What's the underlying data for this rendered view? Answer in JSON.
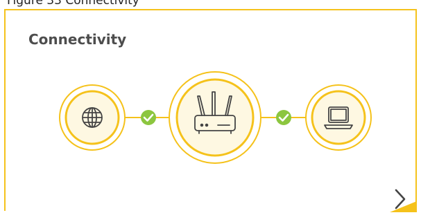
{
  "figure_caption": "Figure 33 Connectivity",
  "card": {
    "title": "Connectivity"
  },
  "status": {
    "internet_link": "connected",
    "device_link": "connected"
  },
  "icons": {
    "internet": "globe-icon",
    "router": "router-icon",
    "device": "laptop-icon",
    "link_ok": "check-circle-icon",
    "next": "chevron-right-icon"
  },
  "colors": {
    "accent": "#f5c21b",
    "ring_inner": "#fef8e2",
    "check": "#8cc63f",
    "icon_stroke": "#444444",
    "title": "#4d4d4d"
  }
}
